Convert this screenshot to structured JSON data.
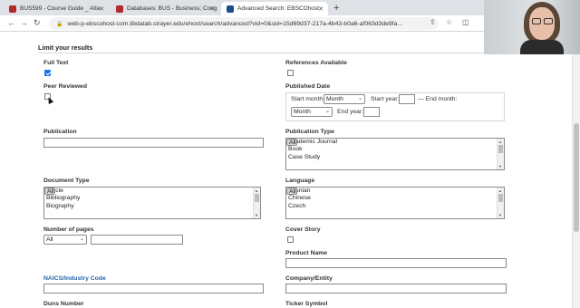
{
  "browser": {
    "tabs": [
      {
        "label": "BUS599 - Course Guide _ Atla",
        "color": "#b22a2a"
      },
      {
        "label": "Databases: BUS - Business; Cong",
        "color": "#b22a2a"
      },
      {
        "label": "Advanced Search: EBSCOhost",
        "color": "#1e4d8c"
      }
    ],
    "new_tab": "+",
    "url": "web-p-ebscohost-com.libdatab.strayer.edu/ehost/search/advanced?vid=0&sid=15d69d37-217a-4b43-b0a6-af063d3de9fa..."
  },
  "limits": {
    "section_title": "Limit your results",
    "full_text": {
      "label": "Full Text",
      "checked": true
    },
    "references_available": {
      "label": "References Available",
      "checked": false
    },
    "peer_reviewed": {
      "label": "Peer Reviewed",
      "checked": false
    },
    "published_date": {
      "label": "Published Date",
      "start_month_label": "Start month:",
      "start_month_value": "Month",
      "start_year_label": "Start year:",
      "dash_end_month_label": "— End month:",
      "end_month_value": "Month",
      "end_year_label": "End year:"
    },
    "publication": {
      "label": "Publication",
      "value": ""
    },
    "publication_type": {
      "label": "Publication Type",
      "options": [
        "All",
        "Academic Journal",
        "Book",
        "Case Study"
      ],
      "selected": "All"
    },
    "document_type": {
      "label": "Document Type",
      "options": [
        "All",
        "Article",
        "Bibliography",
        "Biography"
      ],
      "selected": "All"
    },
    "language": {
      "label": "Language",
      "options": [
        "All",
        "Bosnian",
        "Chinese",
        "Czech"
      ],
      "selected": "All"
    },
    "number_of_pages": {
      "label": "Number of pages",
      "select_value": "All",
      "value": ""
    },
    "cover_story": {
      "label": "Cover Story",
      "checked": false
    },
    "product_name": {
      "label": "Product Name",
      "value": ""
    },
    "naics": {
      "label": "NAICS/Industry Code",
      "value": ""
    },
    "company_entity": {
      "label": "Company/Entity",
      "value": ""
    },
    "duns_number": {
      "label": "Duns Number"
    },
    "ticker_symbol": {
      "label": "Ticker Symbol"
    }
  }
}
